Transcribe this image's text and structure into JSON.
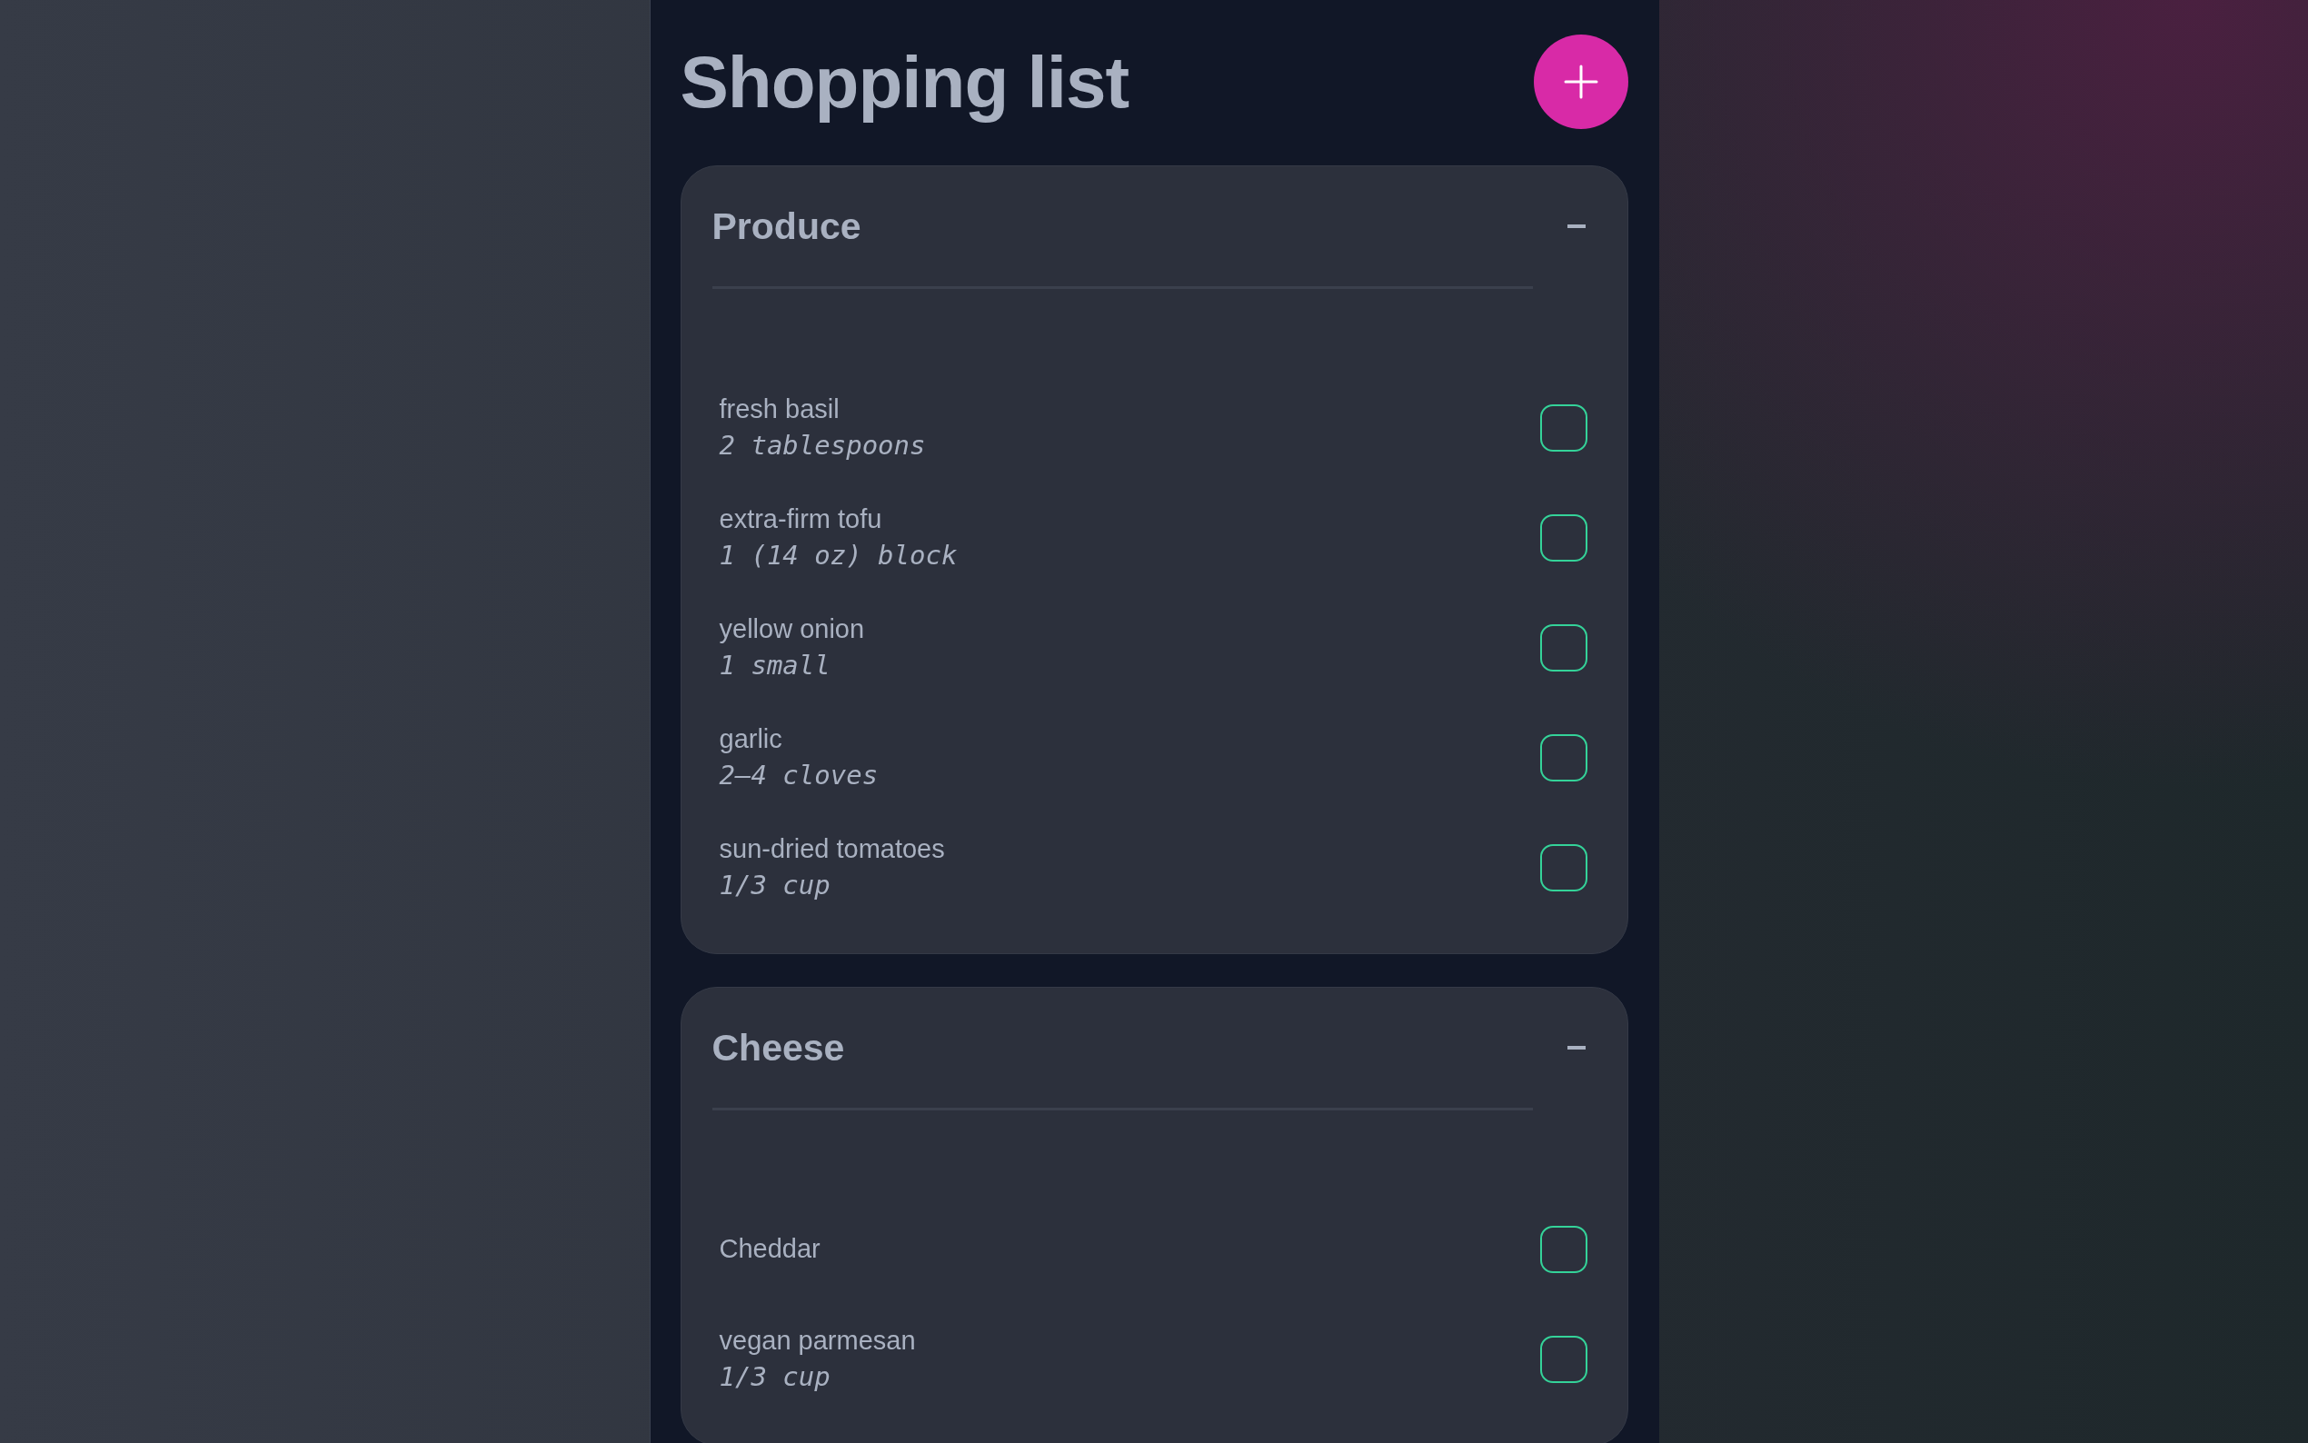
{
  "title": "Shopping list",
  "categories": [
    {
      "name": "Produce",
      "expanded": true,
      "items": [
        {
          "name": "fresh basil",
          "quantity": "2 tablespoons",
          "checked": false
        },
        {
          "name": "extra-firm tofu",
          "quantity": "1 (14 oz) block",
          "checked": false
        },
        {
          "name": "yellow onion",
          "quantity": "1 small",
          "checked": false
        },
        {
          "name": "garlic",
          "quantity": "2–4 cloves",
          "checked": false
        },
        {
          "name": "sun-dried tomatoes",
          "quantity": "1/3 cup",
          "checked": false
        }
      ]
    },
    {
      "name": "Cheese",
      "expanded": true,
      "items": [
        {
          "name": "Cheddar",
          "checked": false
        },
        {
          "name": "vegan parmesan",
          "quantity": "1/3 cup",
          "checked": false
        }
      ]
    }
  ]
}
